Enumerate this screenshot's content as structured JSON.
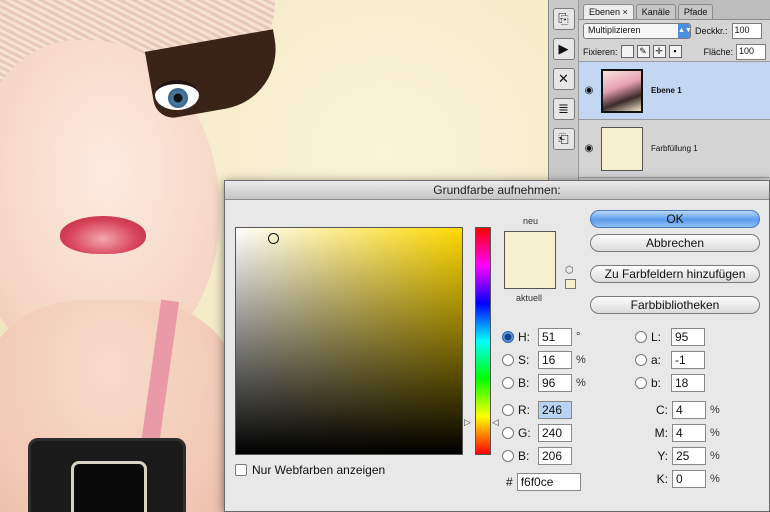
{
  "layers_panel": {
    "tabs": [
      "Ebenen ×",
      "Kanäle",
      "Pfade"
    ],
    "blend_mode": "Multiplizieren",
    "opacity_label": "Deckkr.:",
    "opacity_value": "100",
    "lock_label": "Fixieren:",
    "fill_label": "Fläche:",
    "fill_value": "100",
    "layers": [
      {
        "name": "Ebene 1",
        "selected": true
      },
      {
        "name": "Farbfüllung 1",
        "selected": false
      }
    ]
  },
  "dialog": {
    "title": "Grundfarbe aufnehmen:",
    "new_label": "neu",
    "current_label": "aktuell",
    "buttons": {
      "ok": "OK",
      "cancel": "Abbrechen",
      "add_swatch": "Zu Farbfeldern hinzufügen",
      "libraries": "Farbbibliotheken"
    },
    "web_colors_label": "Nur Webfarben anzeigen",
    "hsb": [
      {
        "label": "H:",
        "value": "51",
        "unit": "°",
        "selected": true
      },
      {
        "label": "S:",
        "value": "16",
        "unit": "%",
        "selected": false
      },
      {
        "label": "B:",
        "value": "96",
        "unit": "%",
        "selected": false
      }
    ],
    "rgb": [
      {
        "label": "R:",
        "value": "246"
      },
      {
        "label": "G:",
        "value": "240"
      },
      {
        "label": "B:",
        "value": "206"
      }
    ],
    "lab": [
      {
        "label": "L:",
        "value": "95"
      },
      {
        "label": "a:",
        "value": "-1"
      },
      {
        "label": "b:",
        "value": "18"
      }
    ],
    "cmyk": [
      {
        "label": "C:",
        "value": "4",
        "unit": "%"
      },
      {
        "label": "M:",
        "value": "4",
        "unit": "%"
      },
      {
        "label": "Y:",
        "value": "25",
        "unit": "%"
      },
      {
        "label": "K:",
        "value": "0",
        "unit": "%"
      }
    ],
    "hex_label": "#",
    "hex_value": "f6f0ce",
    "colors": {
      "current": "#f6f0ce",
      "accent": "#5c9bec"
    }
  }
}
